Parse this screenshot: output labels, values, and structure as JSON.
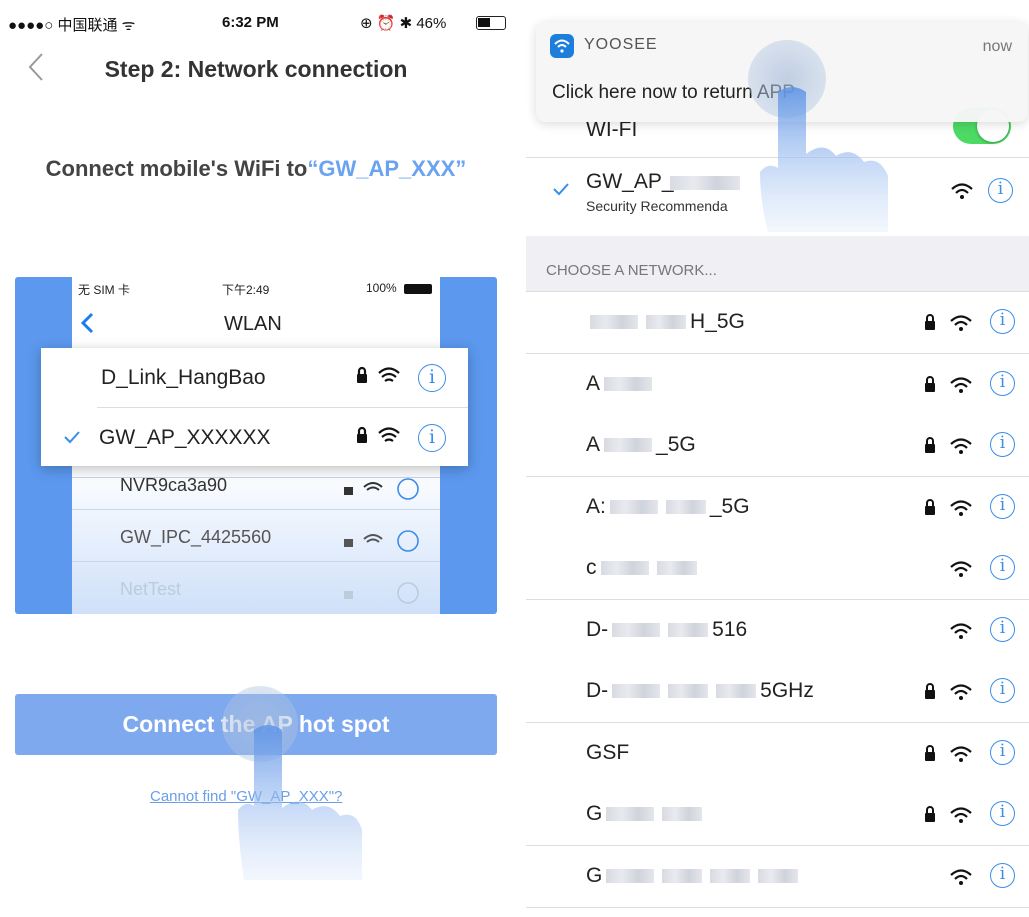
{
  "left": {
    "status": {
      "carrier": "●●●●○ 中国联通 ᯤ",
      "time": "6:32 PM",
      "right": "⊕ ⏰ ✱ 46%",
      "battery_level": 0.46
    },
    "title": "Step 2: Network connection",
    "instruction_prefix": "Connect mobile's WiFi to",
    "instruction_ssid": "“GW_AP_XXX”",
    "mockup": {
      "status_left": "无 SIM 卡",
      "status_time": "下午2:49",
      "status_battery": "100%",
      "wlan_title": "WLAN",
      "popup_rows": [
        "D_Link_HangBao",
        "GW_AP_XXXXXX"
      ],
      "list_rows": [
        "NVR9ca3a90",
        "GW_IPC_4425560",
        "NetTest"
      ]
    },
    "connect_button": "Connect the AP hot spot",
    "cannot_find": "Cannot find \"GW_AP_XXX\"?"
  },
  "right": {
    "notification": {
      "app": "YOOSEE",
      "time": "now",
      "message": "Click here now to return APP"
    },
    "wifi_label": "WI-FI",
    "connected": {
      "name": "GW_AP_",
      "sub": "Security Recommenda"
    },
    "section": "CHOOSE A NETWORK...",
    "networks": [
      {
        "a": "",
        "b": "H_5G",
        "lock": true,
        "blur": 2
      },
      {
        "a": "A",
        "b": "",
        "lock": true,
        "blur": 1
      },
      {
        "a": "A",
        "b": "_5G",
        "lock": true,
        "blur": 1
      },
      {
        "a": "A:",
        "b": "_5G",
        "lock": true,
        "blur": 2
      },
      {
        "a": "c",
        "b": "",
        "lock": false,
        "blur": 2
      },
      {
        "a": "D-",
        "b": "516",
        "lock": false,
        "blur": 2
      },
      {
        "a": "D-",
        "b": "5GHz",
        "lock": true,
        "blur": 3
      },
      {
        "a": "GSF",
        "b": "",
        "lock": true,
        "blur": 0
      },
      {
        "a": "G",
        "b": "",
        "lock": true,
        "blur": 2
      },
      {
        "a": "G",
        "b": "",
        "lock": false,
        "blur": 4
      }
    ],
    "info_glyph": "i"
  },
  "colors": {
    "accent": "#5b98ee",
    "link": "#6aa3f0",
    "toggle": "#4cd964"
  }
}
